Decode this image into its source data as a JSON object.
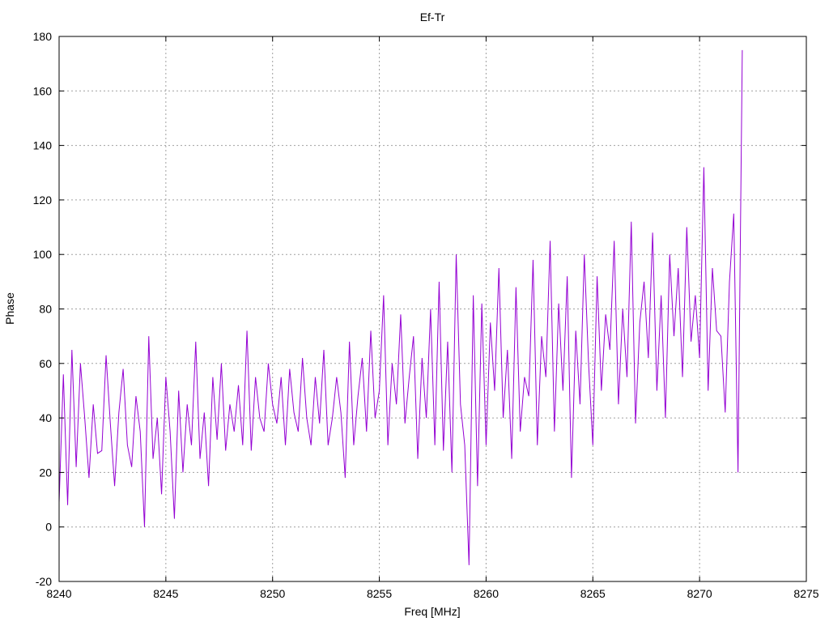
{
  "chart_data": {
    "type": "line",
    "title": "Ef-Tr",
    "xlabel": "Freq [MHz]",
    "ylabel": "Phase",
    "xlim": [
      8240,
      8275
    ],
    "ylim": [
      -20,
      180
    ],
    "xticks": [
      8240,
      8245,
      8250,
      8255,
      8260,
      8265,
      8270,
      8275
    ],
    "yticks": [
      -20,
      0,
      20,
      40,
      60,
      80,
      100,
      120,
      140,
      160,
      180
    ],
    "grid": true,
    "line_color": "#9400d3",
    "series": [
      {
        "x": [
          8240.0,
          8240.2,
          8240.4,
          8240.6,
          8240.8,
          8241.0,
          8241.2,
          8241.4,
          8241.6,
          8241.8,
          8242.0,
          8242.2,
          8242.4,
          8242.6,
          8242.8,
          8243.0,
          8243.2,
          8243.4,
          8243.6,
          8243.8,
          8244.0,
          8244.2,
          8244.4,
          8244.6,
          8244.8,
          8245.0,
          8245.2,
          8245.4,
          8245.6,
          8245.8,
          8246.0,
          8246.2,
          8246.4,
          8246.6,
          8246.8,
          8247.0,
          8247.2,
          8247.4,
          8247.6,
          8247.8,
          8248.0,
          8248.2,
          8248.4,
          8248.6,
          8248.8,
          8249.0,
          8249.2,
          8249.4,
          8249.6,
          8249.8,
          8250.0,
          8250.2,
          8250.4,
          8250.6,
          8250.8,
          8251.0,
          8251.2,
          8251.4,
          8251.6,
          8251.8,
          8252.0,
          8252.2,
          8252.4,
          8252.6,
          8252.8,
          8253.0,
          8253.2,
          8253.4,
          8253.6,
          8253.8,
          8254.0,
          8254.2,
          8254.4,
          8254.6,
          8254.8,
          8255.0,
          8255.2,
          8255.4,
          8255.6,
          8255.8,
          8256.0,
          8256.2,
          8256.4,
          8256.6,
          8256.8,
          8257.0,
          8257.2,
          8257.4,
          8257.6,
          8257.8,
          8258.0,
          8258.2,
          8258.4,
          8258.6,
          8258.8,
          8259.0,
          8259.2,
          8259.4,
          8259.6,
          8259.8,
          8260.0,
          8260.2,
          8260.4,
          8260.6,
          8260.8,
          8261.0,
          8261.2,
          8261.4,
          8261.6,
          8261.8,
          8262.0,
          8262.2,
          8262.4,
          8262.6,
          8262.8,
          8263.0,
          8263.2,
          8263.4,
          8263.6,
          8263.8,
          8264.0,
          8264.2,
          8264.4,
          8264.6,
          8264.8,
          8265.0,
          8265.2,
          8265.4,
          8265.6,
          8265.8,
          8266.0,
          8266.2,
          8266.4,
          8266.6,
          8266.8,
          8267.0,
          8267.2,
          8267.4,
          8267.6,
          8267.8,
          8268.0,
          8268.2,
          8268.4,
          8268.6,
          8268.8,
          8269.0,
          8269.2,
          8269.4,
          8269.6,
          8269.8,
          8270.0,
          8270.2,
          8270.4,
          8270.6,
          8270.8,
          8271.0,
          8271.2,
          8271.4,
          8271.6,
          8271.8,
          8272.0
        ],
        "y": [
          9,
          56,
          8,
          65,
          22,
          60,
          40,
          18,
          45,
          27,
          28,
          63,
          38,
          15,
          42,
          58,
          30,
          22,
          48,
          35,
          0,
          70,
          25,
          40,
          12,
          55,
          35,
          3,
          50,
          20,
          45,
          30,
          68,
          25,
          42,
          15,
          55,
          32,
          60,
          28,
          45,
          35,
          52,
          30,
          72,
          28,
          55,
          40,
          35,
          60,
          45,
          38,
          55,
          30,
          58,
          42,
          35,
          62,
          40,
          30,
          55,
          38,
          65,
          30,
          40,
          55,
          42,
          18,
          68,
          30,
          48,
          62,
          35,
          72,
          40,
          50,
          85,
          30,
          60,
          45,
          78,
          38,
          55,
          70,
          25,
          62,
          40,
          80,
          30,
          90,
          28,
          68,
          20,
          100,
          45,
          30,
          -14,
          85,
          15,
          82,
          30,
          75,
          50,
          95,
          40,
          65,
          25,
          88,
          35,
          55,
          48,
          98,
          30,
          70,
          55,
          105,
          35,
          82,
          50,
          92,
          18,
          72,
          45,
          100,
          60,
          30,
          92,
          50,
          78,
          65,
          105,
          45,
          80,
          55,
          112,
          38,
          75,
          90,
          62,
          108,
          50,
          85,
          40,
          100,
          70,
          95,
          55,
          110,
          68,
          85,
          62,
          132,
          50,
          95,
          72,
          70,
          42,
          90,
          115,
          20,
          175
        ]
      }
    ]
  }
}
